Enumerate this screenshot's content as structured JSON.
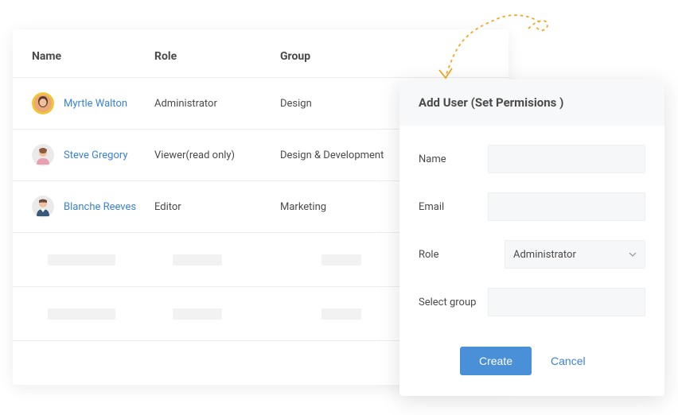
{
  "table": {
    "headers": {
      "name": "Name",
      "role": "Role",
      "group": "Group"
    },
    "rows": [
      {
        "name": "Myrtle Walton",
        "role": "Administrator",
        "group": "Design"
      },
      {
        "name": "Steve Gregory",
        "role": "Viewer(read only)",
        "group": "Design & Development"
      },
      {
        "name": "Blanche Reeves",
        "role": "Editor",
        "group": "Marketing"
      }
    ]
  },
  "modal": {
    "title": "Add User (Set Permisions )",
    "fields": {
      "name": {
        "label": "Name",
        "value": ""
      },
      "email": {
        "label": "Email",
        "value": ""
      },
      "role": {
        "label": "Role",
        "value": "Administrator"
      },
      "group": {
        "label": "Select group",
        "value": ""
      }
    },
    "buttons": {
      "create": "Create",
      "cancel": "Cancel"
    }
  },
  "colors": {
    "link": "#3b82d4",
    "primary": "#4a90d9",
    "arrow": "#f5a623"
  }
}
